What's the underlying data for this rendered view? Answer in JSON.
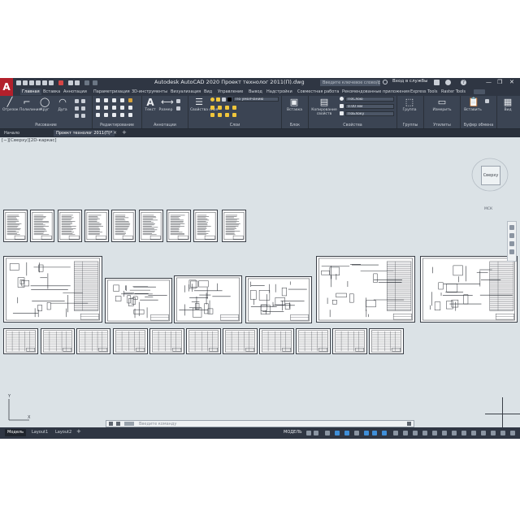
{
  "app": {
    "logo": "A",
    "title": "Autodesk AutoCAD 2020  Проект технолог 2011(П).dwg",
    "search_placeholder": "Введите ключевое слово/фразу",
    "user": "Вход в службы",
    "window_controls": [
      "—",
      "❐",
      "✕"
    ]
  },
  "ribbon_tabs": [
    {
      "label": "Главная",
      "active": true
    },
    {
      "label": "Вставка"
    },
    {
      "label": "Аннотации"
    },
    {
      "label": "Параметризация"
    },
    {
      "label": "3D-инструменты"
    },
    {
      "label": "Визуализация"
    },
    {
      "label": "Вид"
    },
    {
      "label": "Управление"
    },
    {
      "label": "Вывод"
    },
    {
      "label": "Надстройки"
    },
    {
      "label": "Совместная работа"
    },
    {
      "label": "Рекомендованные приложения"
    },
    {
      "label": "Express Tools"
    },
    {
      "label": "Raster Tools"
    }
  ],
  "panels": {
    "draw": {
      "title": "Рисование",
      "buttons": [
        "Отрезок",
        "Полилиния",
        "Круг",
        "Дуга"
      ]
    },
    "modify": {
      "title": "Редактирование"
    },
    "annotation": {
      "title": "Аннотации",
      "buttons": [
        "Текст",
        "Размер"
      ]
    },
    "layers": {
      "title": "Слои",
      "buttons": [
        "Свойства слоя"
      ],
      "layer_dropdown": "По умолчанию"
    },
    "block": {
      "title": "Блок",
      "buttons": [
        "Вставка"
      ]
    },
    "properties": {
      "title": "Свойства",
      "buttons": [
        "Копирование свойств"
      ],
      "color": "ПоСлою",
      "lineweight": "0.00 мм",
      "linetype": "ПоБлоку"
    },
    "groups": {
      "title": "Группы",
      "buttons": [
        "Группа"
      ]
    },
    "utilities": {
      "title": "Утилиты",
      "buttons": [
        "Измерить"
      ]
    },
    "clipboard": {
      "title": "Буфер обмена",
      "buttons": [
        "Вставить"
      ]
    },
    "view": {
      "title": "",
      "buttons": [
        "Вид"
      ]
    }
  },
  "file_tabs": [
    {
      "label": "Начало"
    },
    {
      "label": "Проект технолог 2011(П)*",
      "active": true
    }
  ],
  "viewport": {
    "label": "[−][Сверху][2D-каркас]",
    "viewcube_face": "Сверху",
    "compass_label": "МСК",
    "ucs_x": "X",
    "ucs_y": "Y"
  },
  "command_line": {
    "placeholder": "Введите команду"
  },
  "layout_tabs": [
    {
      "label": "Модель",
      "active": true
    },
    {
      "label": "Layout1"
    },
    {
      "label": "Layout2"
    }
  ],
  "status": {
    "model_label": "МОДЕЛЬ"
  },
  "colors": {
    "chrome": "#3b4453",
    "titlebar": "#2f3643",
    "canvas": "#dbe2e6",
    "logo": "#b3202b",
    "accent": "#3f8fd8"
  }
}
